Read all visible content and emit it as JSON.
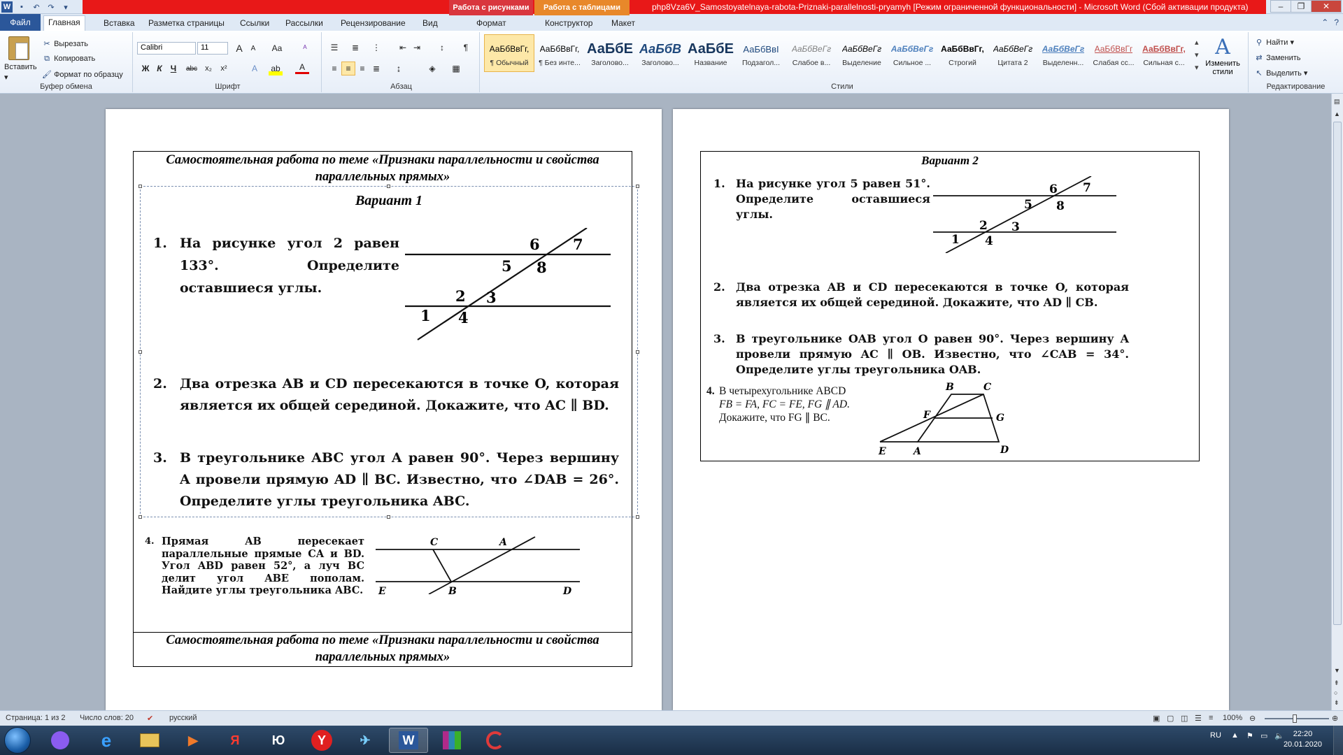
{
  "titlebar": {
    "context_tab_pictures": "Работа с рисунками",
    "context_tab_tables": "Работа с таблицами",
    "title": "php8Vza6V_Samostoyatelnaya-rabota-Priznaki-parallelnosti-pryamyh [Режим ограниченной функциональности] - Microsoft Word (Сбой активации продукта)",
    "accent": "#e81818"
  },
  "tabs": {
    "file": "Файл",
    "items": [
      "Главная",
      "Вставка",
      "Разметка страницы",
      "Ссылки",
      "Рассылки",
      "Рецензирование",
      "Вид",
      "Формат",
      "Конструктор",
      "Макет"
    ]
  },
  "ribbon": {
    "clipboard": {
      "paste": "Вставить",
      "cut": "Вырезать",
      "copy": "Копировать",
      "format_painter": "Формат по образцу",
      "label": "Буфер обмена"
    },
    "font": {
      "name": "Calibri",
      "size": "11",
      "label": "Шрифт",
      "bold": "Ж",
      "italic": "К",
      "underline": "Ч",
      "strike": "abc",
      "subscript": "x₂",
      "superscript": "x²",
      "case": "Aa",
      "grow": "A",
      "shrink": "A",
      "color": "A"
    },
    "paragraph": {
      "label": "Абзац",
      "pilcrow": "¶"
    },
    "styles": {
      "label": "Стили",
      "items": [
        {
          "sample": "АаБбВвГг,",
          "name": "¶ Обычный"
        },
        {
          "sample": "АаБбВвГг,",
          "name": "¶ Без инте..."
        },
        {
          "sample": "АаБбЕ",
          "name": "Заголово..."
        },
        {
          "sample": "АаБбВ",
          "name": "Заголово..."
        },
        {
          "sample": "АаБбЕ",
          "name": "Название"
        },
        {
          "sample": "АаБбВвІ",
          "name": "Подзагол..."
        },
        {
          "sample": "АаБбВеГг",
          "name": "Слабое в..."
        },
        {
          "sample": "АаБбВеГг",
          "name": "Выделение"
        },
        {
          "sample": "АаБбВеГг",
          "name": "Сильное ..."
        },
        {
          "sample": "АаБбВвГг,",
          "name": "Строгий"
        },
        {
          "sample": "АаБбВеГг",
          "name": "Цитата 2"
        },
        {
          "sample": "АаБбВеГг",
          "name": "Выделенн..."
        },
        {
          "sample": "АаБбВвГг",
          "name": "Слабая сс..."
        },
        {
          "sample": "АаБбВвГг,",
          "name": "Сильная с..."
        }
      ],
      "change_styles": "Изменить стили"
    },
    "editing": {
      "label": "Редактирование",
      "find": "Найти",
      "replace": "Заменить",
      "select": "Выделить"
    }
  },
  "document": {
    "page1": {
      "header": "Самостоятельная работа по теме «Признаки параллельности и свойства параллельных прямых»",
      "variant": "Вариант 1",
      "task1_num": "1.",
      "task1_text": "На рисунке угол 2 равен 133°. Определите оставшиеся углы.",
      "task2_num": "2.",
      "task2_text": "Два отрезка AB и CD пересекаются в точке O, которая является их общей серединой. Докажите, что AC ∥ BD.",
      "task3_num": "3.",
      "task3_text": "В треугольнике ABC угол A равен 90°. Через вершину A провели прямую AD ∥ BC. Известно, что ∠DAB = 26°. Определите углы треугольника ABC.",
      "task4_num": "4.",
      "task4_text": "Прямая AB пересекает параллельные прямые CA и BD. Угол ABD равен 52°, а луч BC делит угол ABE пополам. Найдите углы треугольника ABC.",
      "fig1_labels": [
        "6",
        "7",
        "5",
        "8",
        "2",
        "3",
        "1",
        "4"
      ],
      "fig4_labels": [
        "C",
        "A",
        "E",
        "B",
        "D"
      ],
      "footer": "Самостоятельная работа по теме «Признаки параллельности и свойства параллельных прямых»"
    },
    "page2": {
      "variant": "Вариант 2",
      "task1_num": "1.",
      "task1_text": "На рисунке угол 5 равен 51°. Определите оставшиеся углы.",
      "task2_num": "2.",
      "task2_text": "Два отрезка AB и CD пересекаются в точке O, которая является их общей серединой. Докажите, что AD ∥ CB.",
      "task3_num": "3.",
      "task3_text": "В треугольнике OAB угол O равен 90°. Через вершину A провели прямую AC ∥ OB. Известно, что ∠CAB = 34°. Определите углы треугольника OAB.",
      "task4_num": "4.",
      "task4_line1": "В четырехугольнике ABCD",
      "task4_line2": "FB = FA, FC = FE, FG ∥ AD.",
      "task4_line3": "Докажите, что FG ∥ BC.",
      "fig1_labels": [
        "6",
        "7",
        "5",
        "8",
        "2",
        "3",
        "1",
        "4"
      ],
      "fig4_labels": [
        "B",
        "C",
        "F",
        "G",
        "E",
        "A",
        "D"
      ]
    }
  },
  "statusbar": {
    "page": "Страница: 1 из 2",
    "words": "Число слов: 20",
    "language": "русский",
    "zoom": "100%"
  },
  "taskbar": {
    "lang": "RU",
    "time": "22:20",
    "date": "20.01.2020",
    "word_icon": "W",
    "yandex_icon": "Я",
    "yu_icon": "Ю",
    "y_icon": "Y"
  }
}
